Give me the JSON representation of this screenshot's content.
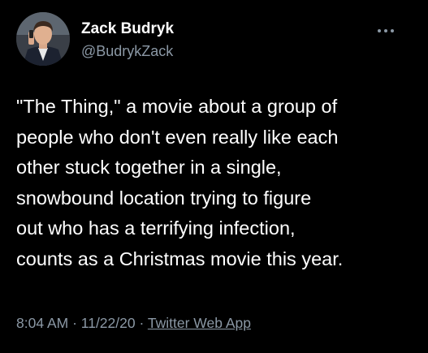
{
  "author": {
    "name": "Zack Budryk",
    "handle": "@BudrykZack",
    "avatar_icon": "profile-photo"
  },
  "menu": {
    "icon": "more-horizontal-icon"
  },
  "tweet": {
    "lines": [
      "\"The Thing,\" a movie about a group of",
      "people who don't even really like each",
      "other stuck together in a single,",
      "snowbound location trying to figure",
      "out who has a terrifying infection,",
      "counts as a Christmas movie this year."
    ]
  },
  "meta": {
    "time": "8:04 AM",
    "separator1": " · ",
    "date": "11/22/20",
    "separator2": " · ",
    "source": "Twitter Web App"
  },
  "colors": {
    "background": "#000000",
    "text": "#ffffff",
    "secondary": "#8b98a5"
  }
}
